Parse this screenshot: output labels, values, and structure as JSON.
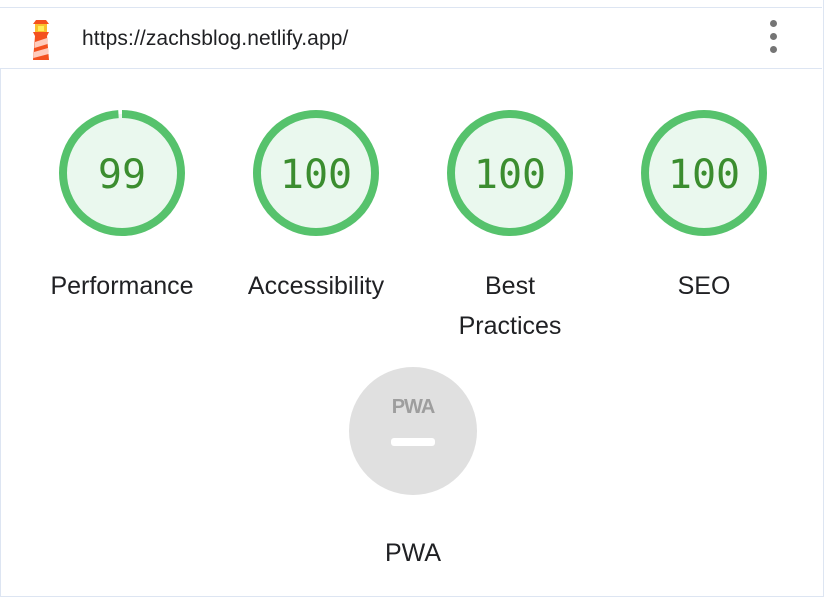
{
  "header": {
    "url": "https://zachsblog.netlify.app/",
    "logo_icon": "lighthouse-icon",
    "menu_icon": "more-vert-icon"
  },
  "gauges": [
    {
      "name": "performance",
      "score": "99",
      "fraction": 0.99,
      "label": "Performance"
    },
    {
      "name": "accessibility",
      "score": "100",
      "fraction": 1.0,
      "label": "Accessibility"
    },
    {
      "name": "best-practices",
      "score": "100",
      "fraction": 1.0,
      "label_line1": "Best",
      "label_line2": "Practices"
    },
    {
      "name": "seo",
      "score": "100",
      "fraction": 1.0,
      "label": "SEO"
    }
  ],
  "pwa": {
    "badge_text": "PWA",
    "label": "PWA",
    "icon": "pwa-badge-icon"
  },
  "colors": {
    "pass_ring": "#56c26c",
    "pass_fill": "#eaf8ee",
    "pass_text": "#3b8d2f",
    "pwa_fill": "#e0e0e0",
    "pwa_mark": "#ffffff",
    "pwa_text": "#9e9e9e"
  }
}
